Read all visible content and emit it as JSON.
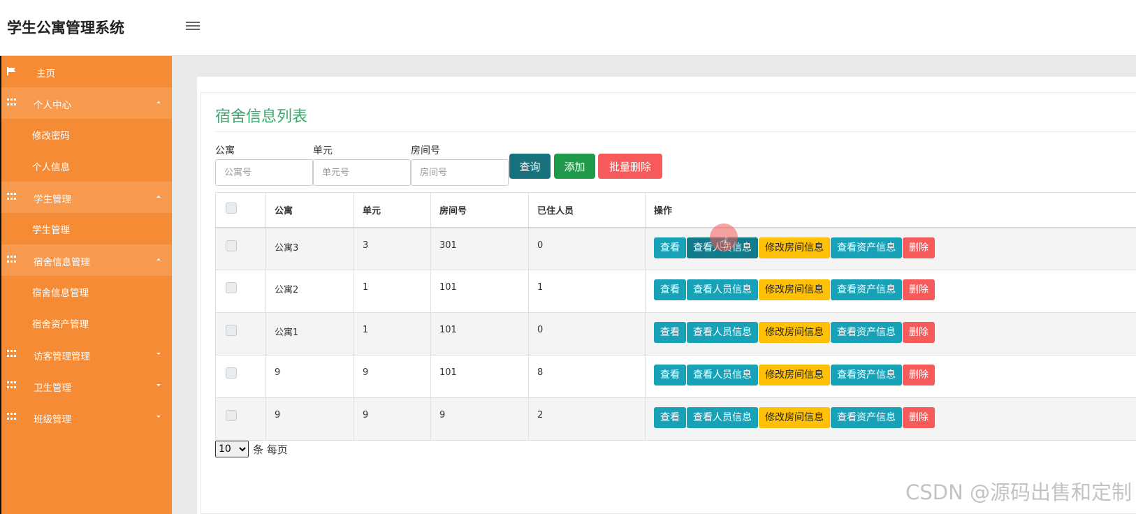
{
  "app": {
    "title": "学生公寓管理系统"
  },
  "sidebar": {
    "home": "主页",
    "groups": [
      {
        "label": "个人中心",
        "items": [
          "修改密码",
          "个人信息"
        ]
      },
      {
        "label": "学生管理",
        "items": [
          "学生管理"
        ]
      },
      {
        "label": "宿舍信息管理",
        "items": [
          "宿舍信息管理",
          "宿舍资产管理"
        ]
      },
      {
        "label": "访客管理管理",
        "items": []
      },
      {
        "label": "卫生管理",
        "items": []
      },
      {
        "label": "班级管理",
        "items": []
      }
    ]
  },
  "main": {
    "title": "宿舍信息列表",
    "filters": [
      {
        "label": "公寓",
        "placeholder": "公寓号"
      },
      {
        "label": "单元",
        "placeholder": "单元号"
      },
      {
        "label": "房间号",
        "placeholder": "房间号"
      }
    ],
    "buttons": {
      "query": "查询",
      "add": "添加",
      "batch_delete": "批量删除"
    },
    "colors": {
      "query": "#17727d",
      "add": "#1f9a4b",
      "batch_delete": "#f65a5a"
    },
    "table": {
      "headers": [
        "公寓",
        "单元",
        "房间号",
        "已住人员",
        "操作"
      ],
      "actions": {
        "view": "查看",
        "people": "查看人员信息",
        "edit": "修改房间信息",
        "assets": "查看资产信息",
        "delete": "删除"
      },
      "rows": [
        [
          "公寓3",
          "3",
          "301",
          "0"
        ],
        [
          "公寓2",
          "1",
          "101",
          "1"
        ],
        [
          "公寓1",
          "1",
          "101",
          "0"
        ],
        [
          "9",
          "9",
          "101",
          "8"
        ],
        [
          "9",
          "9",
          "9",
          "2"
        ]
      ]
    },
    "pagination": {
      "page_size": "10",
      "suffix": "条 每页"
    }
  },
  "watermark": "CSDN @源码出售和定制"
}
